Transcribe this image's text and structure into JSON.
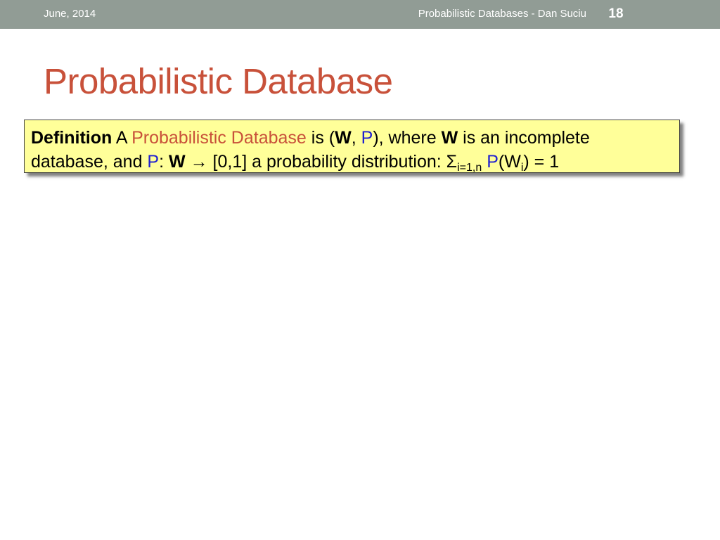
{
  "header": {
    "date": "June, 2014",
    "course": "Probabilistic Databases - Dan Suciu",
    "page_number": "18"
  },
  "title": "Probabilistic Database",
  "definition": {
    "label": "Definition",
    "intro_article": " A ",
    "term": "Probabilistic Database",
    "is_open": " is (",
    "W": "W",
    "comma": ", ",
    "P": "P",
    "where_clause": "), where ",
    "incomplete_clause": " is an incomplete",
    "line2_start": "database, and ",
    "colon": ": ",
    "arrow": " → ",
    "range_text": "[0,1] a probability distribution: Σ",
    "sum_subscript": "i=1,n",
    "space": " ",
    "paren_open": "(W",
    "w_subscript": "i",
    "equals_one": ") = 1"
  },
  "colors": {
    "header_bar": "#919c95",
    "title": "#c8513a",
    "box_background": "#ffff99",
    "term_orange": "#c8513a",
    "symbol_blue": "#1f1fd0"
  }
}
